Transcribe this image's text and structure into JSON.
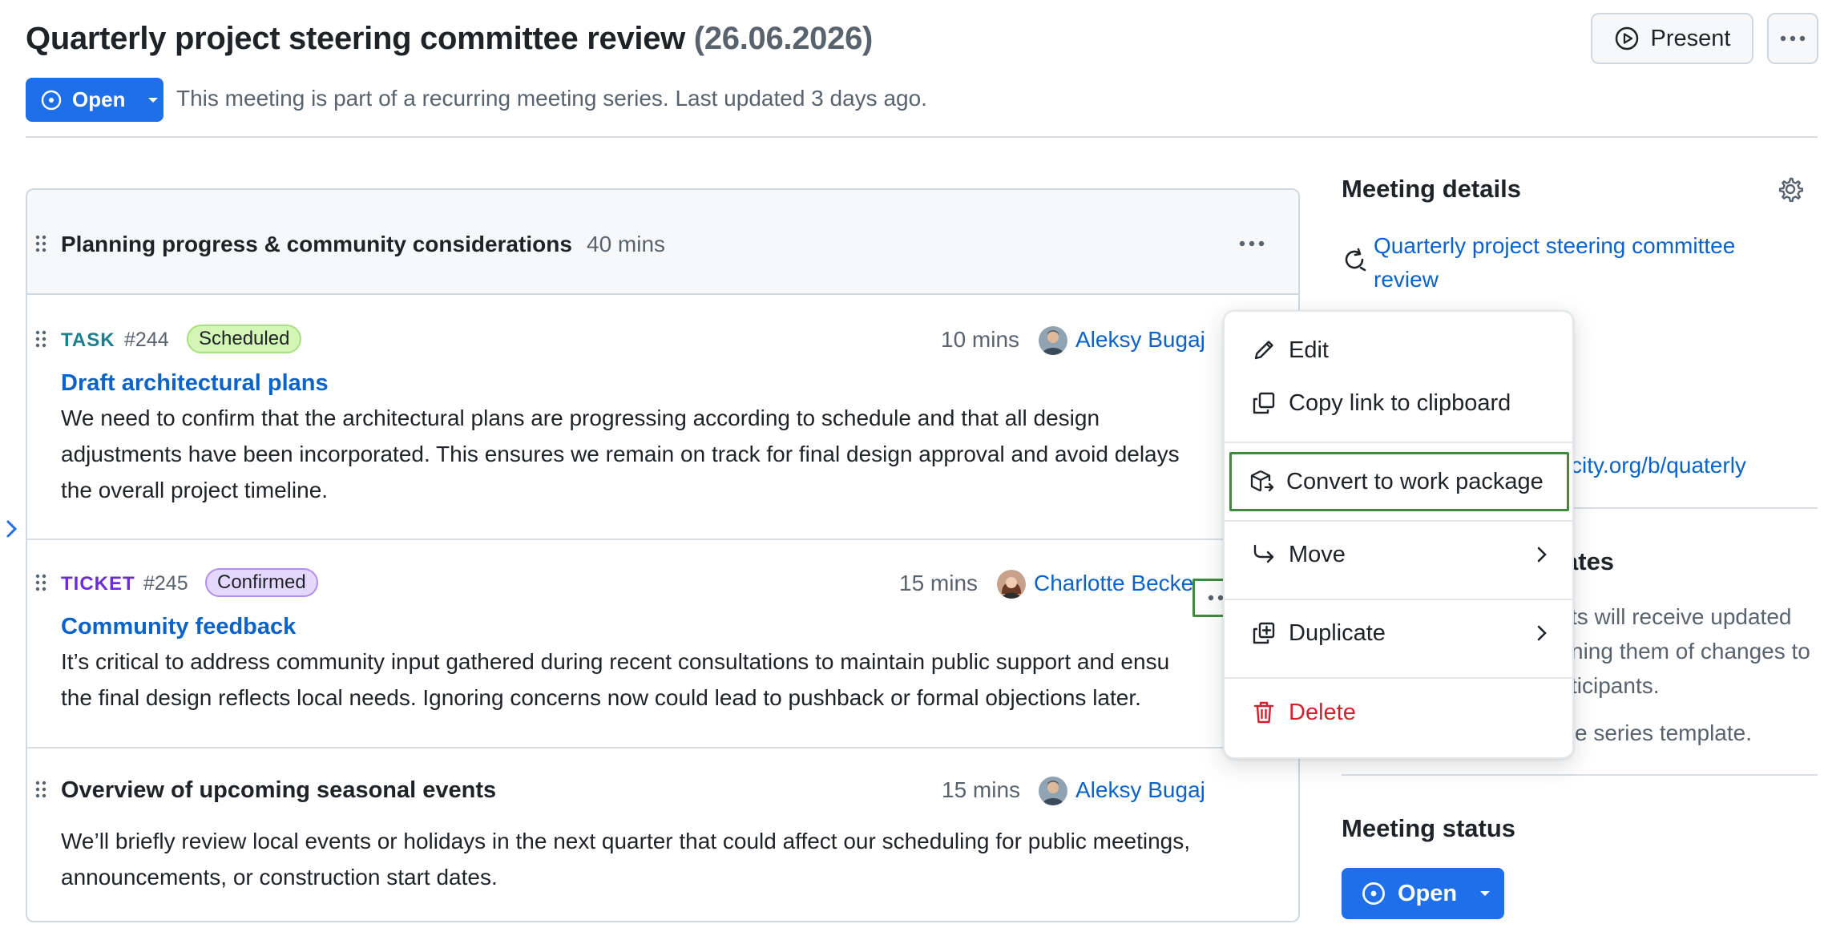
{
  "header": {
    "title": "Quarterly project steering committee review",
    "date": "(26.06.2026)",
    "present_label": "Present",
    "status_label": "Open",
    "subtitle": "This meeting is part of a recurring meeting series. Last updated 3 days ago."
  },
  "agenda": {
    "section": {
      "title": "Planning progress & community considerations",
      "duration": "40 mins"
    },
    "items": [
      {
        "type": "TASK",
        "id": "#244",
        "status": "Scheduled",
        "duration": "10 mins",
        "presenter": "Aleksy Bugaj",
        "title": "Draft architectural plans",
        "description_lines": [
          "We need to confirm that the architectural plans are progressing according to schedule and that all design",
          "adjustments have been incorporated. This ensures we remain on track for final design approval and avoid delays",
          "the overall project timeline."
        ]
      },
      {
        "type": "TICKET",
        "id": "#245",
        "status": "Confirmed",
        "duration": "15 mins",
        "presenter": "Charlotte Becker",
        "title": "Community feedback",
        "description_lines": [
          "It’s critical to address community input gathered during recent consultations to maintain public support and ensu",
          "the final design reflects local needs. Ignoring concerns now could lead to pushback or formal objections later."
        ]
      },
      {
        "title": "Overview of upcoming seasonal events",
        "duration": "15 mins",
        "presenter": "Aleksy Bugaj",
        "description_lines": [
          "We’ll briefly review local events or holidays in the next quarter that could affect our scheduling for public meetings,",
          "announcements, or construction start dates."
        ]
      }
    ]
  },
  "sidebar": {
    "details_title": "Meeting details",
    "series_link_line1": "Quarterly project steering committee",
    "series_link_line2": "review",
    "link_fragment": "city.org/b/quaterly",
    "updates_fragment": "ates",
    "updates_text": [
      "ts will receive updated",
      "ning them of changes to",
      "ticipants."
    ],
    "template_text": "e series template.",
    "status_title": "Meeting status",
    "status_label": "Open"
  },
  "context_menu": {
    "items": [
      {
        "label": "Edit",
        "icon": "pencil-icon"
      },
      {
        "label": "Copy link to clipboard",
        "icon": "copy-icon"
      },
      {
        "label": "Convert to work package",
        "icon": "package-icon"
      },
      {
        "label": "Move",
        "icon": "move-arrow-icon"
      },
      {
        "label": "Duplicate",
        "icon": "duplicate-icon"
      },
      {
        "label": "Delete",
        "icon": "trash-icon"
      }
    ]
  },
  "colors": {
    "primary": "#1f6feb",
    "link": "#0b63c9",
    "danger": "#cf222e",
    "highlight": "#3d8c3d",
    "task": "#1a7f8e",
    "ticket": "#6e2bd9"
  }
}
